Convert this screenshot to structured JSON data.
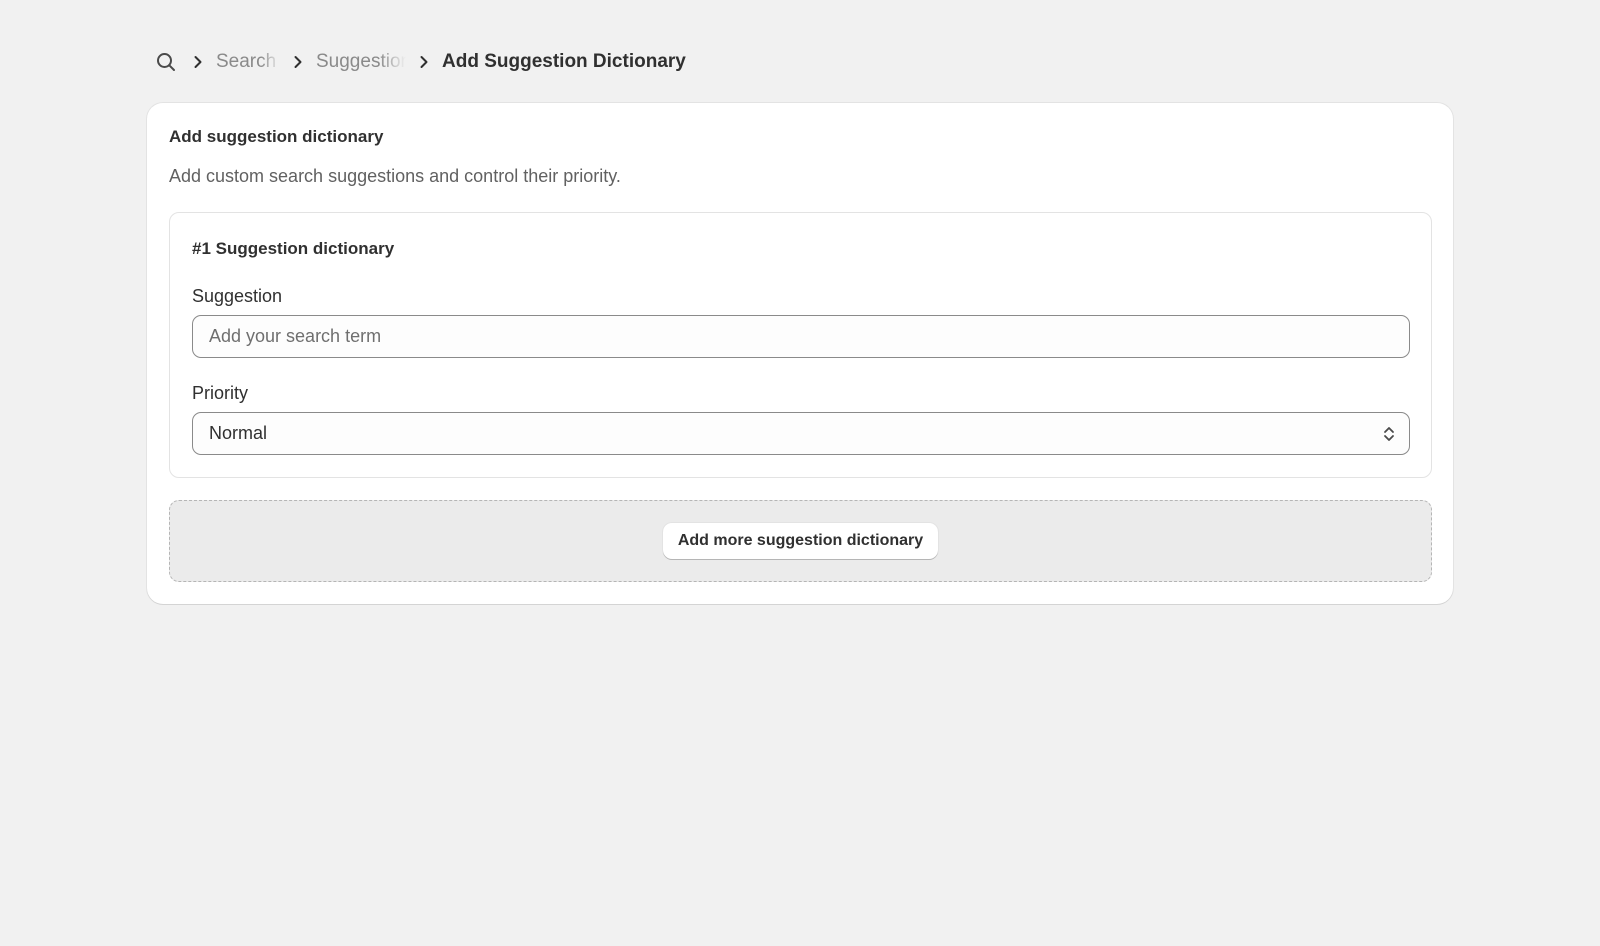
{
  "breadcrumb": {
    "icon": "search-icon",
    "items": [
      {
        "label": "Search"
      },
      {
        "label": "Suggestions"
      }
    ],
    "current": "Add Suggestion Dictionary"
  },
  "card": {
    "title": "Add suggestion dictionary",
    "description": "Add custom search suggestions and control their priority.",
    "dictionaries": [
      {
        "title": "#1 Suggestion dictionary",
        "suggestion": {
          "label": "Suggestion",
          "value": "",
          "placeholder": "Add your search term"
        },
        "priority": {
          "label": "Priority",
          "selected": "Normal"
        }
      }
    ],
    "add_more_label": "Add more suggestion dictionary"
  }
}
